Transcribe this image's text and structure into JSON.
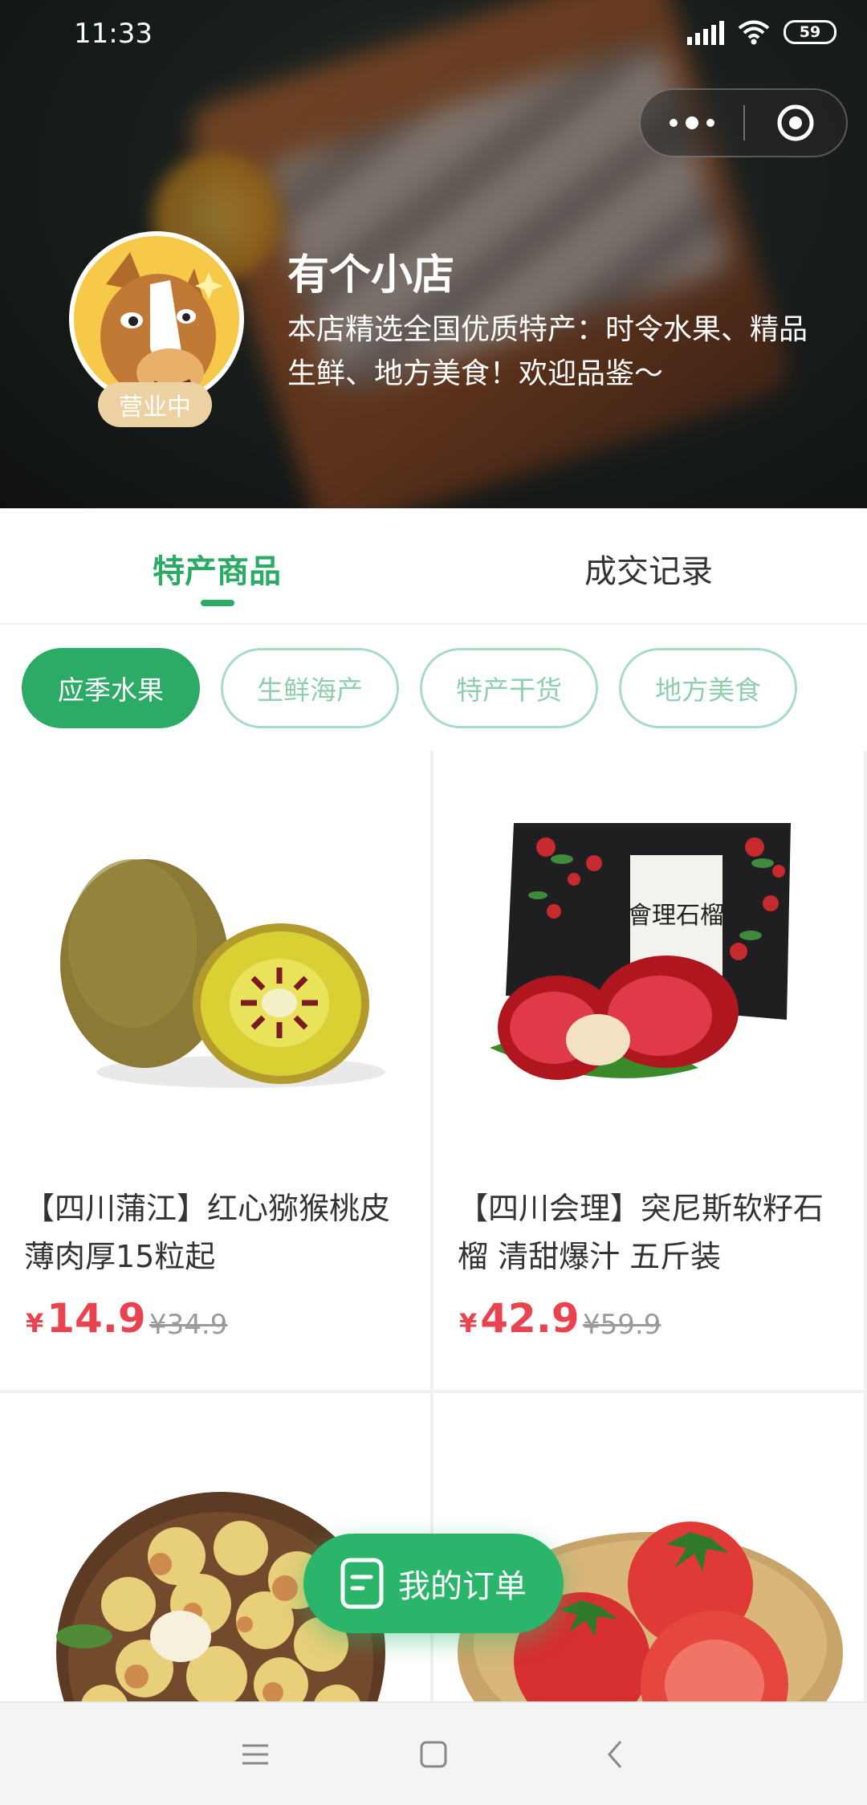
{
  "status_bar": {
    "time": "11:33",
    "battery": "59"
  },
  "shop": {
    "name": "有个小店",
    "description": "本店精选全国优质特产：时令水果、精品生鲜、地方美食！欢迎品鉴～",
    "status_badge": "营业中"
  },
  "tabs": [
    {
      "label": "特产商品",
      "active": true
    },
    {
      "label": "成交记录",
      "active": false
    }
  ],
  "categories": [
    {
      "label": "应季水果",
      "active": true
    },
    {
      "label": "生鲜海产",
      "active": false
    },
    {
      "label": "特产干货",
      "active": false
    },
    {
      "label": "地方美食",
      "active": false
    }
  ],
  "products": [
    {
      "title": "【四川蒲江】红心猕猴桃皮薄肉厚15粒起",
      "currency": "¥",
      "price": "14.9",
      "original_price": "¥34.9",
      "image": "kiwi"
    },
    {
      "title": "【四川会理】突尼斯软籽石榴 清甜爆汁 五斤装",
      "currency": "¥",
      "price": "42.9",
      "original_price": "¥59.9",
      "image": "pomegranate-gift-box"
    },
    {
      "title": "",
      "image": "winter-jujube"
    },
    {
      "title": "",
      "image": "tomatoes"
    }
  ],
  "pomegranate_box_text": "會理石榴",
  "order_button": {
    "label": "我的订单",
    "icon": "order-document-icon"
  },
  "colors": {
    "accent": "#2bab66",
    "price": "#e8434e",
    "chip_border": "#a8dcbf"
  }
}
